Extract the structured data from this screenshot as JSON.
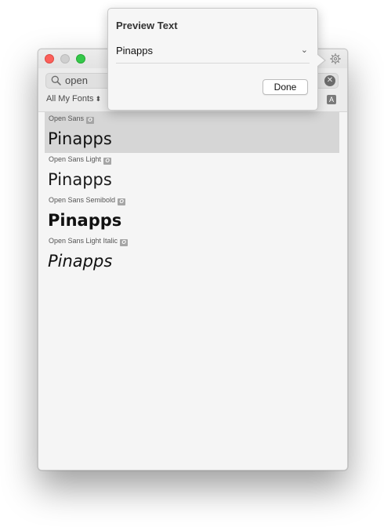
{
  "search": {
    "value": "open"
  },
  "collection": {
    "label": "All My Fonts",
    "chevron": "⌃⌄"
  },
  "icons": {
    "gear": "gear-icon",
    "search": "search-icon",
    "clear": "clear-icon",
    "font_size": "A"
  },
  "popover": {
    "title": "Preview Text",
    "selected_text": "Pinapps",
    "done_label": "Done"
  },
  "fonts": [
    {
      "name": "Open Sans",
      "sample": "Pinapps",
      "selected": true,
      "badge": "O"
    },
    {
      "name": "Open Sans Light",
      "sample": "Pinapps",
      "selected": false,
      "badge": "O"
    },
    {
      "name": "Open Sans Semibold",
      "sample": "Pinapps",
      "selected": false,
      "badge": "O"
    },
    {
      "name": "Open Sans Light Italic",
      "sample": "Pinapps",
      "selected": false,
      "badge": "O"
    }
  ],
  "colors": {
    "close": "#fc605b",
    "minimize": "#cfcfcf",
    "zoom": "#34c84a",
    "selected_row": "#d6d6d6"
  }
}
